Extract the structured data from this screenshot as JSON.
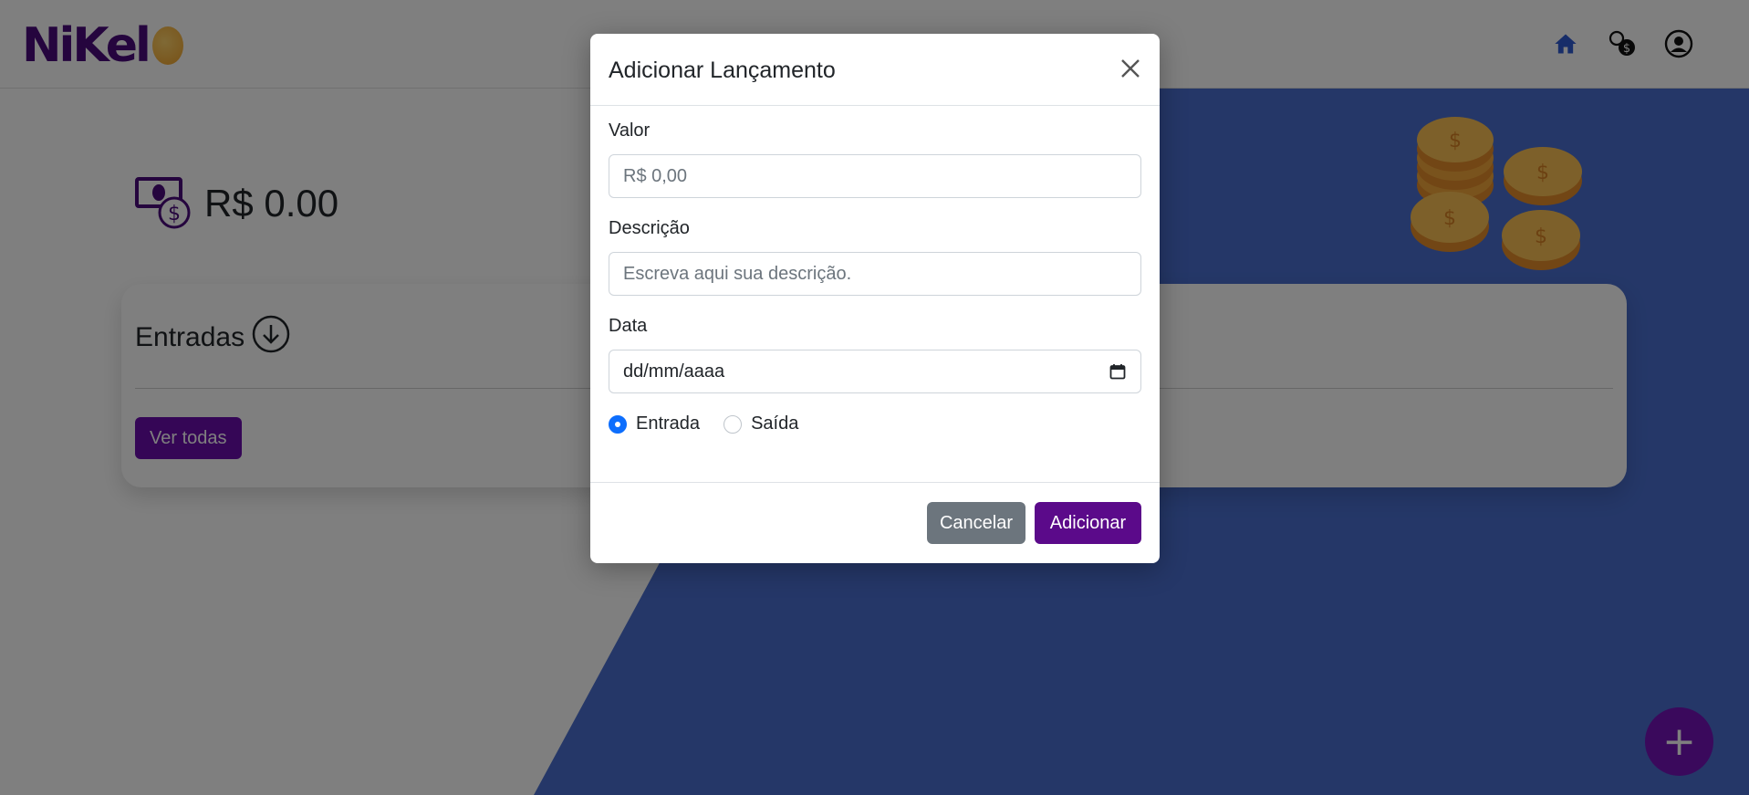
{
  "header": {
    "logo_text": "NiKel",
    "icons": [
      "home-icon",
      "transactions-icon",
      "user-icon"
    ]
  },
  "balance": {
    "value": "R$ 0.00",
    "icon": "money-icon"
  },
  "card": {
    "title": "Entradas",
    "title_icon": "arrow-down-circle-icon",
    "button_label": "Ver todas"
  },
  "fab": {
    "label": "+"
  },
  "modal": {
    "title": "Adicionar Lançamento",
    "fields": {
      "valor_label": "Valor",
      "valor_placeholder": "R$ 0,00",
      "descricao_label": "Descrição",
      "descricao_placeholder": "Escreva aqui sua descrição.",
      "data_label": "Data",
      "data_placeholder": "dd/mm/aaaa"
    },
    "radio": {
      "option1": "Entrada",
      "option2": "Saída",
      "selected": "Entrada"
    },
    "buttons": {
      "cancel": "Cancelar",
      "submit": "Adicionar"
    }
  },
  "colors": {
    "brand_purple": "#5b0a8a",
    "blue_background": "#4a6fd0",
    "cancel_gray": "#6c757d",
    "radio_blue": "#0d6efd"
  }
}
